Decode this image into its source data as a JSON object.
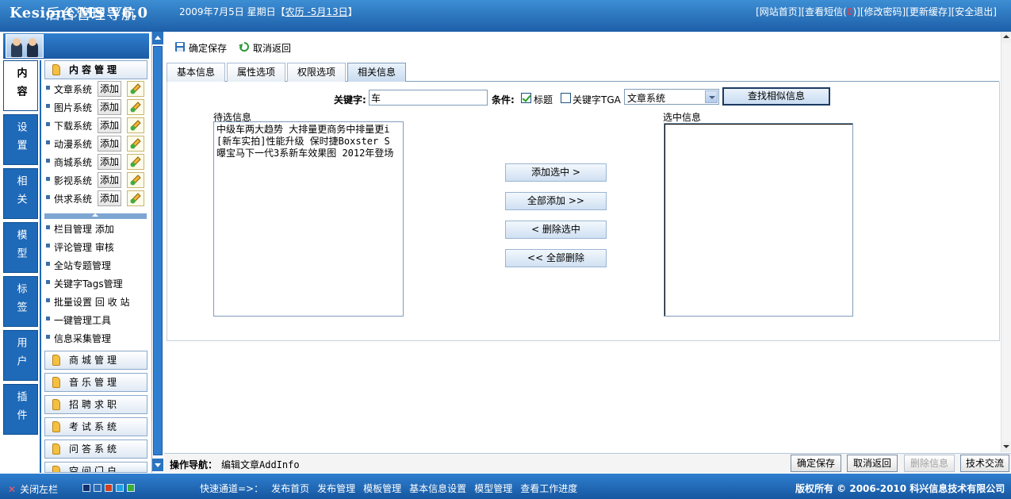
{
  "header": {
    "logo": "KesionCMS V6.0",
    "date_prefix": "2009年7月5日 星期日【",
    "lunar": "农历 -5月13日",
    "date_suffix": "】",
    "links": [
      "[网站首页]",
      "[查看短信(",
      "0",
      ")]",
      "[修改密码]",
      "[更新缓存]",
      "[安全退出]"
    ]
  },
  "sidebar": {
    "title": "后台管理导航",
    "tabs": [
      "内容",
      "设置",
      "相关",
      "模型",
      "标签",
      "用户",
      "插件"
    ],
    "content_module": "内容管理",
    "systems": [
      {
        "name": "文章系统",
        "add": "添加"
      },
      {
        "name": "图片系统",
        "add": "添加"
      },
      {
        "name": "下载系统",
        "add": "添加"
      },
      {
        "name": "动漫系统",
        "add": "添加"
      },
      {
        "name": "商城系统",
        "add": "添加"
      },
      {
        "name": "影视系统",
        "add": "添加"
      },
      {
        "name": "供求系统",
        "add": "添加"
      }
    ],
    "manage_items": [
      {
        "label": "栏目管理",
        "extra": "添加"
      },
      {
        "label": "评论管理",
        "extra": "审核"
      },
      {
        "label": "全站专题管理",
        "extra": ""
      },
      {
        "label": "关键字Tags管理",
        "extra": ""
      },
      {
        "label": "批量设置",
        "extra": "回 收 站"
      },
      {
        "label": "一键管理工具",
        "extra": ""
      },
      {
        "label": "信息采集管理",
        "extra": ""
      }
    ],
    "modules": [
      "商城管理",
      "音乐管理",
      "招聘求职",
      "考试系统",
      "问答系统",
      "空间门户"
    ]
  },
  "toolbar": {
    "save": "确定保存",
    "cancel": "取消返回"
  },
  "tabs": [
    "基本信息",
    "属性选项",
    "权限选项",
    "相关信息"
  ],
  "search": {
    "keyword_label": "关键字:",
    "keyword_value": "车",
    "condition_label": "条件:",
    "cond_title": "标题",
    "cond_title_checked": true,
    "cond_tag": "关键字TGA",
    "cond_tag_checked": false,
    "system_select": "文章系统",
    "find_button": "查找相似信息"
  },
  "lists": {
    "candidates_label": "待选信息",
    "chosen_label": "选中信息",
    "candidates": [
      "中级车两大趋势 大排量更商务中排量更i",
      "[新车实拍]性能升级 保时捷Boxster S",
      "曝宝马下一代3系新车效果图 2012年登场"
    ],
    "chosen": []
  },
  "move_buttons": [
    "添加选中 >",
    "全部添加 >>",
    "< 删除选中",
    "<< 全部删除"
  ],
  "status": {
    "nav_label": "操作导航：",
    "nav_path": "编辑文章AddInfo",
    "buttons": [
      "确定保存",
      "取消返回",
      "删除信息",
      "技术交流"
    ]
  },
  "footer": {
    "close_left": "关闭左栏",
    "swatches": [
      "#14306a",
      "#2c6db2",
      "#d43f1c",
      "#1ea0e6",
      "#36b03a"
    ],
    "quick_label": "快速通道=>：",
    "quick_links": [
      "发布首页",
      "发布管理",
      "模板管理",
      "基本信息设置",
      "模型管理",
      "查看工作进度"
    ],
    "copyright": "版权所有 © 2006-2010 科兴信息技术有限公司"
  }
}
